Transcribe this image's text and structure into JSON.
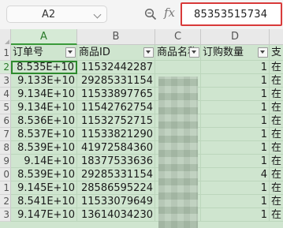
{
  "name_box": {
    "value": "A2"
  },
  "formula_bar": {
    "fx_label": "fx",
    "value": "85353515734"
  },
  "columns": [
    "A",
    "B",
    "C",
    "D",
    ""
  ],
  "rows": [
    "1",
    "2",
    "3",
    "4",
    "5",
    "6",
    "7",
    "8",
    "9",
    "0",
    "1",
    "2",
    "3"
  ],
  "headers": [
    "订单号",
    "商品ID",
    "商品名称",
    "订购数量",
    "支"
  ],
  "data": [
    [
      "8.535E+10",
      "11532442287",
      "",
      "1",
      "在"
    ],
    [
      "9.133E+10",
      "29285331154",
      "",
      "1",
      "在"
    ],
    [
      "9.134E+10",
      "11533897765",
      "",
      "1",
      "在"
    ],
    [
      "9.134E+10",
      "11542762754",
      "",
      "1",
      "在"
    ],
    [
      "8.536E+10",
      "11532752715",
      "",
      "1",
      "在"
    ],
    [
      "8.537E+10",
      "11533821290",
      "",
      "1",
      "在"
    ],
    [
      "8.539E+10",
      "41972584360",
      "",
      "1",
      "在"
    ],
    [
      "9.14E+10",
      "18377533636",
      "",
      "1",
      "在"
    ],
    [
      "8.539E+10",
      "29285331154",
      "",
      "4",
      "在"
    ],
    [
      "9.145E+10",
      "28586595224",
      "",
      "1",
      "在"
    ],
    [
      "8.541E+10",
      "11533079649",
      "",
      "1",
      "在"
    ],
    [
      "9.147E+10",
      "13614034230",
      "",
      "1",
      "在"
    ]
  ],
  "icons": {
    "zoom": "zoom-icon",
    "filter": "filter-dropdown-icon"
  },
  "colors": {
    "selection": "#2e8b2e",
    "formula_highlight": "#d93a3a",
    "cell_fill": "#cfe5cf"
  }
}
